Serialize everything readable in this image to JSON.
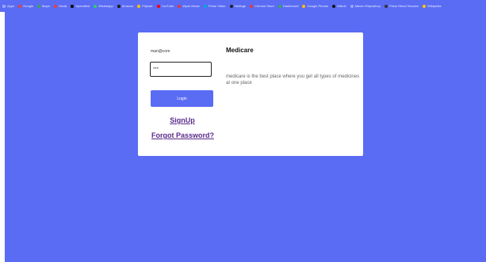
{
  "bookmarks": [
    {
      "label": "Apps",
      "color": "#9aa4ff",
      "shape": "grid-icon"
    },
    {
      "label": "Google",
      "color": "#ea4335",
      "shape": "google-icon"
    },
    {
      "label": "Maps",
      "color": "#34a853",
      "shape": "maps-icon"
    },
    {
      "label": "Gmail",
      "color": "#ea4335",
      "shape": "gmail-icon"
    },
    {
      "label": "Speedtest",
      "color": "#111111",
      "shape": "speedtest-icon"
    },
    {
      "label": "WhatsApp",
      "color": "#25d366",
      "shape": "whatsapp-icon"
    },
    {
      "label": "Amazon",
      "color": "#222222",
      "shape": "amazon-icon"
    },
    {
      "label": "Flipkart",
      "color": "#f7c600",
      "shape": "flipkart-icon"
    },
    {
      "label": "YouTube",
      "color": "#ff0000",
      "shape": "youtube-icon"
    },
    {
      "label": "Wynk Music",
      "color": "#e53935",
      "shape": "wynk-icon"
    },
    {
      "label": "Prime Video",
      "color": "#00a8e1",
      "shape": "prime-video-icon"
    },
    {
      "label": "Settings",
      "color": "#222222",
      "shape": "gear-icon"
    },
    {
      "label": "Chrome Store",
      "color": "#e53935",
      "shape": "chrome-store-icon"
    },
    {
      "label": "Dashboard",
      "color": "#34a853",
      "shape": "dashboard-icon"
    },
    {
      "label": "Google Photos",
      "color": "#fbbc05",
      "shape": "photos-icon"
    },
    {
      "label": "Github",
      "color": "#111111",
      "shape": "github-icon"
    },
    {
      "label": "Maven Repository",
      "color": "#9aa4ff",
      "shape": "maven-icon"
    },
    {
      "label": "Prism Ethod Session",
      "color": "#333333",
      "shape": "globe-icon"
    },
    {
      "label": "Wikipedia",
      "color": "#f7c600",
      "shape": "wikipedia-icon"
    }
  ],
  "login": {
    "username_label": "man@com",
    "password_value": "***",
    "login_button": "Login",
    "signup_link": "SignUp",
    "forgot_link": "Forgot Password?"
  },
  "info": {
    "title": "Medicare",
    "description": "medicare is the best place where you get all types of medicines at one place"
  },
  "colors": {
    "accent": "#5a6cf4",
    "link": "#5b2a8a",
    "card": "#ffffff"
  }
}
